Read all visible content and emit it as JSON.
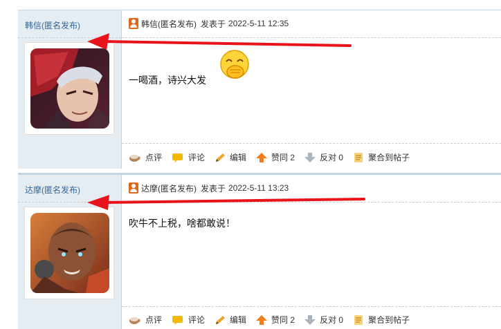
{
  "posts": [
    {
      "author": "韩信(匿名发布)",
      "head_author": "韩信(匿名发布)",
      "posted_label": "发表于",
      "date": "2022-5-11 12:35",
      "content": "一喝酒，诗兴大发",
      "emoji": "face-with-hand-over-mouth-icon",
      "actions": {
        "comment_short": "点评",
        "reply": "评论",
        "edit": "编辑",
        "support": "赞同 2",
        "oppose": "反对 0",
        "aggregate": "聚合到帖子"
      }
    },
    {
      "author": "达摩(匿名发布)",
      "head_author": "达摩(匿名发布)",
      "posted_label": "发表于",
      "date": "2022-5-11 13:23",
      "content": "吹牛不上税，啥都敢说！",
      "actions": {
        "comment_short": "点评",
        "reply": "评论",
        "edit": "编辑",
        "support": "赞同 2",
        "oppose": "反对 0",
        "aggregate": "聚合到帖子"
      }
    }
  ],
  "colors": {
    "sidebar_bg": "#e5edf2",
    "border": "#c2d5e3",
    "link": "#336699",
    "annotation_arrow": "#e8131b",
    "badge": "#d9691e"
  }
}
